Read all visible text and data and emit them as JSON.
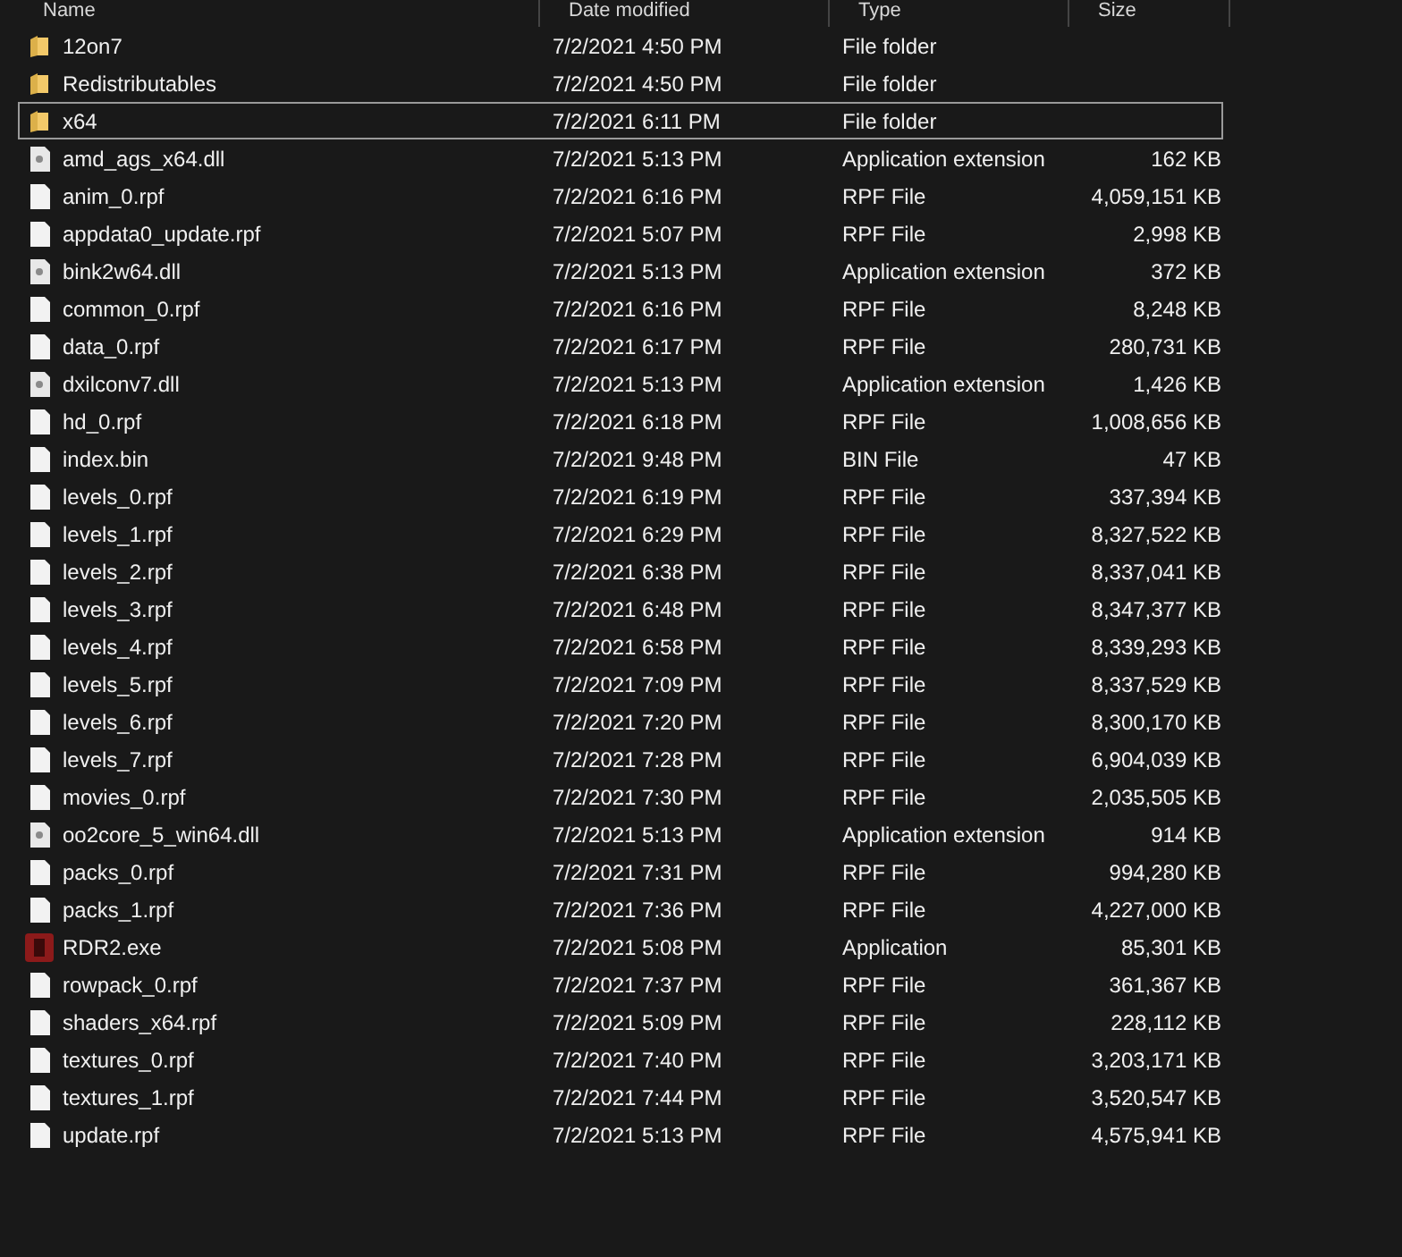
{
  "columns": [
    "Name",
    "Date modified",
    "Type",
    "Size"
  ],
  "files": [
    {
      "name": "12on7",
      "date": "7/2/2021 4:50 PM",
      "type": "File folder",
      "kind": "folder",
      "focused": false
    },
    {
      "name": "Redistributables",
      "date": "7/2/2021 4:50 PM",
      "type": "File folder",
      "kind": "folder",
      "focused": false
    },
    {
      "name": "x64",
      "date": "7/2/2021 6:11 PM",
      "type": "File folder",
      "kind": "folder",
      "focused": true
    },
    {
      "name": "amd_ags_x64.dll",
      "date": "7/2/2021 5:13 PM",
      "type": "Application extension",
      "size": "162 KB",
      "kind": "dll",
      "focused": false
    },
    {
      "name": "anim_0.rpf",
      "date": "7/2/2021 6:16 PM",
      "type": "RPF File",
      "size": "4,059,151 KB",
      "kind": "file",
      "focused": false
    },
    {
      "name": "appdata0_update.rpf",
      "date": "7/2/2021 5:07 PM",
      "type": "RPF File",
      "size": "2,998 KB",
      "kind": "file",
      "focused": false
    },
    {
      "name": "bink2w64.dll",
      "date": "7/2/2021 5:13 PM",
      "type": "Application extension",
      "size": "372 KB",
      "kind": "dll",
      "focused": false
    },
    {
      "name": "common_0.rpf",
      "date": "7/2/2021 6:16 PM",
      "type": "RPF File",
      "size": "8,248 KB",
      "kind": "file",
      "focused": false
    },
    {
      "name": "data_0.rpf",
      "date": "7/2/2021 6:17 PM",
      "type": "RPF File",
      "size": "280,731 KB",
      "kind": "file",
      "focused": false
    },
    {
      "name": "dxilconv7.dll",
      "date": "7/2/2021 5:13 PM",
      "type": "Application extension",
      "size": "1,426 KB",
      "kind": "dll",
      "focused": false
    },
    {
      "name": "hd_0.rpf",
      "date": "7/2/2021 6:18 PM",
      "type": "RPF File",
      "size": "1,008,656 KB",
      "kind": "file",
      "focused": false
    },
    {
      "name": "index.bin",
      "date": "7/2/2021 9:48 PM",
      "type": "BIN File",
      "size": "47 KB",
      "kind": "file",
      "focused": false
    },
    {
      "name": "levels_0.rpf",
      "date": "7/2/2021 6:19 PM",
      "type": "RPF File",
      "size": "337,394 KB",
      "kind": "file",
      "focused": false
    },
    {
      "name": "levels_1.rpf",
      "date": "7/2/2021 6:29 PM",
      "type": "RPF File",
      "size": "8,327,522 KB",
      "kind": "file",
      "focused": false
    },
    {
      "name": "levels_2.rpf",
      "date": "7/2/2021 6:38 PM",
      "type": "RPF File",
      "size": "8,337,041 KB",
      "kind": "file",
      "focused": false
    },
    {
      "name": "levels_3.rpf",
      "date": "7/2/2021 6:48 PM",
      "type": "RPF File",
      "size": "8,347,377 KB",
      "kind": "file",
      "focused": false
    },
    {
      "name": "levels_4.rpf",
      "date": "7/2/2021 6:58 PM",
      "type": "RPF File",
      "size": "8,339,293 KB",
      "kind": "file",
      "focused": false
    },
    {
      "name": "levels_5.rpf",
      "date": "7/2/2021 7:09 PM",
      "type": "RPF File",
      "size": "8,337,529 KB",
      "kind": "file",
      "focused": false
    },
    {
      "name": "levels_6.rpf",
      "date": "7/2/2021 7:20 PM",
      "type": "RPF File",
      "size": "8,300,170 KB",
      "kind": "file",
      "focused": false
    },
    {
      "name": "levels_7.rpf",
      "date": "7/2/2021 7:28 PM",
      "type": "RPF File",
      "size": "6,904,039 KB",
      "kind": "file",
      "focused": false
    },
    {
      "name": "movies_0.rpf",
      "date": "7/2/2021 7:30 PM",
      "type": "RPF File",
      "size": "2,035,505 KB",
      "kind": "file",
      "focused": false
    },
    {
      "name": "oo2core_5_win64.dll",
      "date": "7/2/2021 5:13 PM",
      "type": "Application extension",
      "size": "914 KB",
      "kind": "dll",
      "focused": false
    },
    {
      "name": "packs_0.rpf",
      "date": "7/2/2021 7:31 PM",
      "type": "RPF File",
      "size": "994,280 KB",
      "kind": "file",
      "focused": false
    },
    {
      "name": "packs_1.rpf",
      "date": "7/2/2021 7:36 PM",
      "type": "RPF File",
      "size": "4,227,000 KB",
      "kind": "file",
      "focused": false
    },
    {
      "name": "RDR2.exe",
      "date": "7/2/2021 5:08 PM",
      "type": "Application",
      "size": "85,301 KB",
      "kind": "exe",
      "focused": false
    },
    {
      "name": "rowpack_0.rpf",
      "date": "7/2/2021 7:37 PM",
      "type": "RPF File",
      "size": "361,367 KB",
      "kind": "file",
      "focused": false
    },
    {
      "name": "shaders_x64.rpf",
      "date": "7/2/2021 5:09 PM",
      "type": "RPF File",
      "size": "228,112 KB",
      "kind": "file",
      "focused": false
    },
    {
      "name": "textures_0.rpf",
      "date": "7/2/2021 7:40 PM",
      "type": "RPF File",
      "size": "3,203,171 KB",
      "kind": "file",
      "focused": false
    },
    {
      "name": "textures_1.rpf",
      "date": "7/2/2021 7:44 PM",
      "type": "RPF File",
      "size": "3,520,547 KB",
      "kind": "file",
      "focused": false
    },
    {
      "name": "update.rpf",
      "date": "7/2/2021 5:13 PM",
      "type": "RPF File",
      "size": "4,575,941 KB",
      "kind": "file",
      "focused": false
    }
  ]
}
